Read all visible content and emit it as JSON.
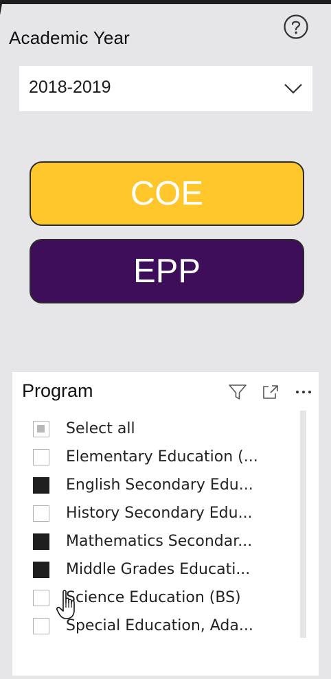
{
  "filters": {
    "academic_year_label": "Academic Year",
    "academic_year_value": "2018-2019"
  },
  "nav_buttons": {
    "coe_label": "COE",
    "coe_color": "#ffc72c",
    "epp_label": "EPP",
    "epp_color": "#3f0e5b"
  },
  "program_slicer": {
    "title": "Program",
    "items": [
      {
        "label": "Select all",
        "state": "partial"
      },
      {
        "label": "Elementary Education (...",
        "state": "unchecked"
      },
      {
        "label": "English Secondary Edu...",
        "state": "checked"
      },
      {
        "label": "History Secondary Edu...",
        "state": "unchecked"
      },
      {
        "label": "Mathematics Secondar...",
        "state": "checked"
      },
      {
        "label": "Middle Grades Educati...",
        "state": "checked"
      },
      {
        "label": "Science Education (BS)",
        "state": "unchecked"
      },
      {
        "label": "Special Education, Ada...",
        "state": "unchecked"
      }
    ]
  },
  "icons": {
    "help": "help-circle-icon",
    "dropdown": "chevron-down-icon",
    "filter": "filter-icon",
    "focus_mode": "focus-mode-icon",
    "more_options": "more-options-icon",
    "cursor": "hand-pointer-icon"
  }
}
